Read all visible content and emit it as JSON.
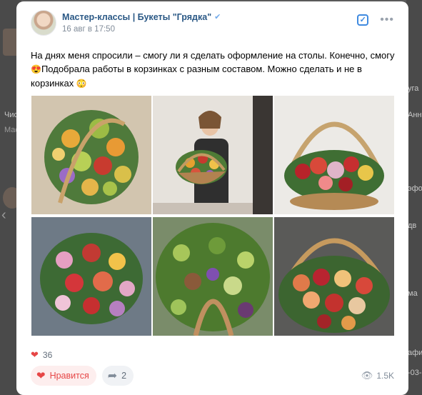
{
  "background": {
    "left_items": [
      "Чис",
      "Мас"
    ],
    "right_items": [
      "уга",
      "Анн",
      "эфо",
      "дв",
      "ма",
      "афи",
      "-03-"
    ]
  },
  "post": {
    "author": "Мастер-классы | Букеты \"Грядка\"",
    "date": "16 авг в 17:50",
    "text_line1": "На днях меня спросили – смогу ли я сделать оформление на столы. Конечно, смогу",
    "text_line2": "Подобрала работы в корзинках с разным составом. Можно сделать и не в",
    "text_line3": "корзинках",
    "emoji_1": "😍",
    "emoji_2": "😳"
  },
  "photos": [
    {
      "name": "photo-1",
      "desc": "fruit bouquet"
    },
    {
      "name": "photo-2",
      "desc": "woman with basket"
    },
    {
      "name": "photo-3",
      "desc": "basket with handle"
    },
    {
      "name": "photo-4",
      "desc": "orchid fruit basket"
    },
    {
      "name": "photo-5",
      "desc": "grape basket"
    },
    {
      "name": "photo-6",
      "desc": "large fruit basket"
    }
  ],
  "stats": {
    "likes": "36",
    "like_label": "Нравится",
    "shares": "2",
    "views": "1.5K"
  },
  "icons": {
    "verified": "verified-icon",
    "mark": "check-square-icon",
    "more": "more-icon",
    "like": "heart-icon",
    "share": "share-icon",
    "views": "eye-icon",
    "close": "close-icon"
  },
  "colors": {
    "accent": "#2a5885",
    "like": "#e64646",
    "muted": "#818c99"
  }
}
